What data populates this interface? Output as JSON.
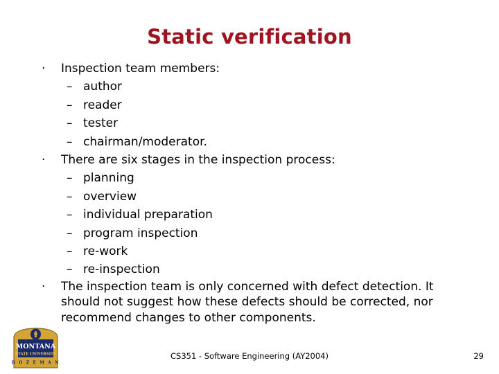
{
  "slide": {
    "title": "Static verification",
    "title_color": "#9e1420",
    "background_color": "#ffffff",
    "text_color": "#000000"
  },
  "markers": {
    "level1": "·",
    "level2": "–"
  },
  "body": {
    "groups": [
      {
        "heading": "Inspection team members:",
        "items": [
          "author",
          "reader",
          "tester",
          "chairman/moderator."
        ]
      },
      {
        "heading": "There are six stages in the inspection process:",
        "items": [
          "planning",
          "overview",
          "individual preparation",
          "program inspection",
          "re-work",
          "re-inspection"
        ]
      }
    ],
    "paragraph": "The inspection team is only concerned with defect detection.  It should not suggest how these defects should be corrected, nor recommend changes to other components."
  },
  "footer": {
    "course": "CS351 - Software Engineering (AY2004)",
    "page_number": "29"
  },
  "logo": {
    "name": "montana-state-university-logo",
    "line1": "MONTANA",
    "line2": "STATE UNIVERSITY",
    "line3": "B O Z E M A N",
    "gold": "#d4a436",
    "navy": "#1b2a6b"
  }
}
